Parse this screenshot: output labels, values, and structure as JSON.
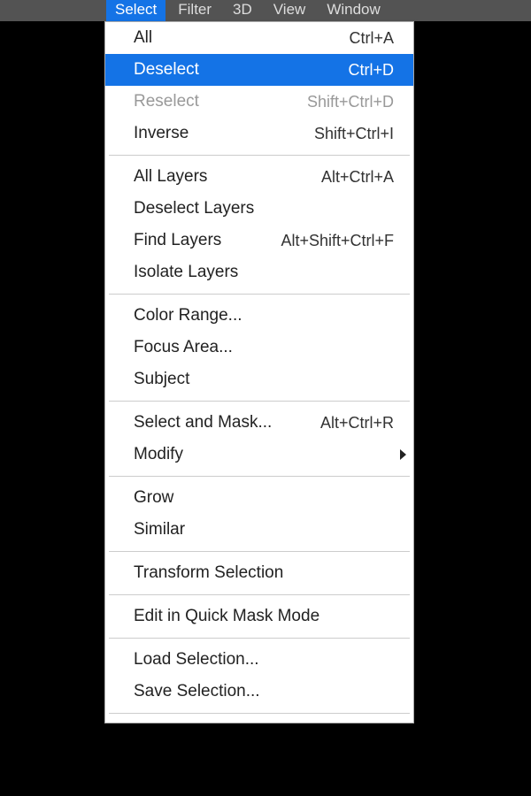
{
  "menubar": {
    "items": [
      {
        "label": "Select",
        "active": true
      },
      {
        "label": "Filter"
      },
      {
        "label": "3D"
      },
      {
        "label": "View"
      },
      {
        "label": "Window"
      }
    ]
  },
  "dropdown": {
    "groups": [
      [
        {
          "label": "All",
          "shortcut": "Ctrl+A"
        },
        {
          "label": "Deselect",
          "shortcut": "Ctrl+D",
          "highlight": true
        },
        {
          "label": "Reselect",
          "shortcut": "Shift+Ctrl+D",
          "disabled": true
        },
        {
          "label": "Inverse",
          "shortcut": "Shift+Ctrl+I"
        }
      ],
      [
        {
          "label": "All Layers",
          "shortcut": "Alt+Ctrl+A"
        },
        {
          "label": "Deselect Layers"
        },
        {
          "label": "Find Layers",
          "shortcut": "Alt+Shift+Ctrl+F"
        },
        {
          "label": "Isolate Layers"
        }
      ],
      [
        {
          "label": "Color Range..."
        },
        {
          "label": "Focus Area..."
        },
        {
          "label": "Subject"
        }
      ],
      [
        {
          "label": "Select and Mask...",
          "shortcut": "Alt+Ctrl+R"
        },
        {
          "label": "Modify",
          "submenu": true
        }
      ],
      [
        {
          "label": "Grow"
        },
        {
          "label": "Similar"
        }
      ],
      [
        {
          "label": "Transform Selection"
        }
      ],
      [
        {
          "label": "Edit in Quick Mask Mode"
        }
      ],
      [
        {
          "label": "Load Selection..."
        },
        {
          "label": "Save Selection..."
        }
      ]
    ]
  }
}
